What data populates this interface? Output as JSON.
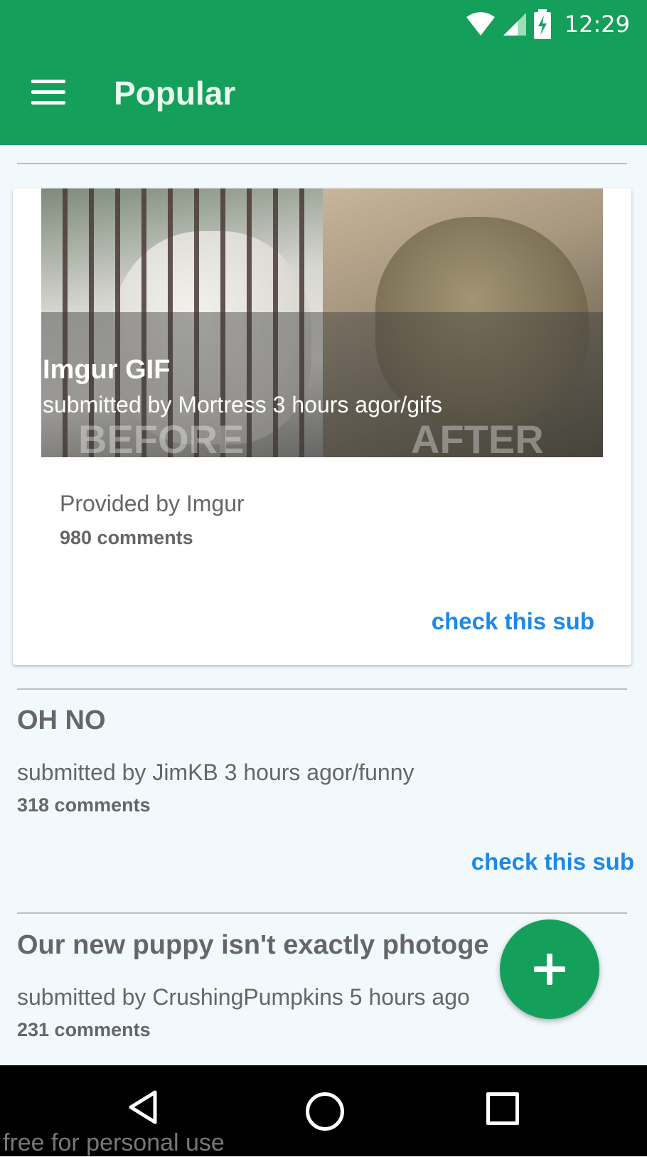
{
  "status_bar": {
    "time": "12:29"
  },
  "app_bar": {
    "title": "Popular"
  },
  "featured_post": {
    "title": "Imgur GIF",
    "subtitle": "submitted by Mortress 3 hours agor/gifs",
    "watermark_before": "BEFORE",
    "watermark_after": "AFTER",
    "provider": "Provided by Imgur",
    "comments": "980 comments",
    "action": "check this sub"
  },
  "posts": [
    {
      "title": "OH NO",
      "subtitle": "submitted by JimKB 3 hours agor/funny",
      "comments": "318 comments",
      "action": "check this sub"
    },
    {
      "title": "Our new puppy isn't exactly photoge",
      "subtitle": "submitted by CrushingPumpkins 5 hours ago",
      "comments": "231 comments"
    }
  ],
  "footer_note": "free for personal use",
  "colors": {
    "primary": "#14a05a",
    "link": "#1e88e5",
    "text": "#666666"
  }
}
